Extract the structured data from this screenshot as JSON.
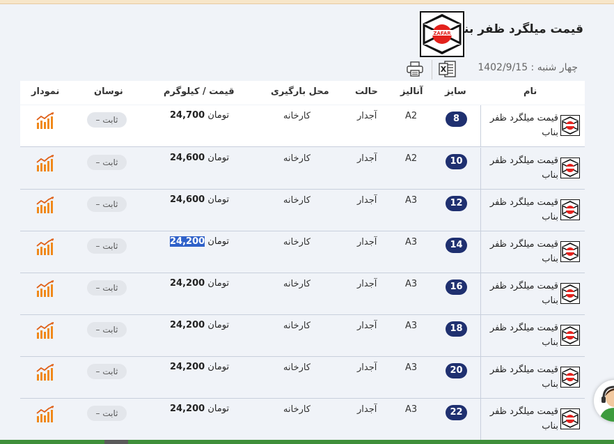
{
  "header": {
    "title": "قیمت میلگرد ظفر بناب",
    "logo_text": "ZAFAR",
    "date": "چهار شنبه : 1402/9/15",
    "excel_label": "X"
  },
  "table": {
    "columns": {
      "name": "نام",
      "size": "سایز",
      "analysis": "آنالیز",
      "state": "حالت",
      "location": "محل بارگیری",
      "price": "قیمت / کیلوگرم",
      "fluctuation": "نوسان",
      "chart": "نمودار"
    },
    "rows": [
      {
        "name": "قیمت میلگرد ظفر بناب",
        "size": "8",
        "analysis": "A2",
        "state": "آجدار",
        "location": "کارخانه",
        "price": "24,700",
        "unit": "تومان",
        "fluctuation": "ثابت –"
      },
      {
        "name": "قیمت میلگرد ظفر بناب",
        "size": "10",
        "analysis": "A2",
        "state": "آجدار",
        "location": "کارخانه",
        "price": "24,600",
        "unit": "تومان",
        "fluctuation": "ثابت –"
      },
      {
        "name": "قیمت میلگرد ظفر بناب",
        "size": "12",
        "analysis": "A3",
        "state": "آجدار",
        "location": "کارخانه",
        "price": "24,600",
        "unit": "تومان",
        "fluctuation": "ثابت –"
      },
      {
        "name": "قیمت میلگرد ظفر بناب",
        "size": "14",
        "analysis": "A3",
        "state": "آجدار",
        "location": "کارخانه",
        "price": "24,200",
        "unit": "تومان",
        "fluctuation": "ثابت –"
      },
      {
        "name": "قیمت میلگرد ظفر بناب",
        "size": "16",
        "analysis": "A3",
        "state": "آجدار",
        "location": "کارخانه",
        "price": "24,200",
        "unit": "تومان",
        "fluctuation": "ثابت –"
      },
      {
        "name": "قیمت میلگرد ظفر بناب",
        "size": "18",
        "analysis": "A3",
        "state": "آجدار",
        "location": "کارخانه",
        "price": "24,200",
        "unit": "تومان",
        "fluctuation": "ثابت –"
      },
      {
        "name": "قیمت میلگرد ظفر بناب",
        "size": "20",
        "analysis": "A3",
        "state": "آجدار",
        "location": "کارخانه",
        "price": "24,200",
        "unit": "تومان",
        "fluctuation": "ثابت –"
      },
      {
        "name": "قیمت میلگرد ظفر بناب",
        "size": "22",
        "analysis": "A3",
        "state": "آجدار",
        "location": "کارخانه",
        "price": "24,200",
        "unit": "تومان",
        "fluctuation": "ثابت –"
      }
    ]
  },
  "colors": {
    "size_badge": "#1f3070",
    "selection": "#2f61c9",
    "chart_icon": "#f08a1c",
    "logo_red": "#e3211c"
  }
}
